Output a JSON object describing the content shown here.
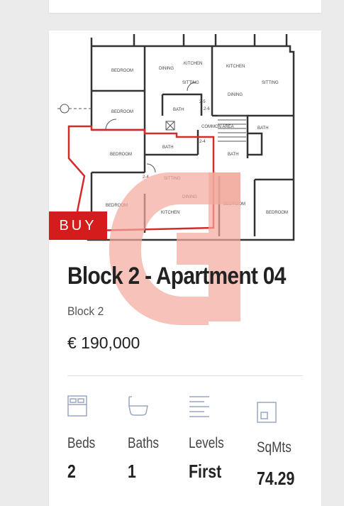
{
  "listing": {
    "badge": "BUY",
    "title": "Block 2 - Apartment 04",
    "block": "Block 2",
    "price": "€ 190,000",
    "watermark_color": "#f2a89c",
    "accent_color": "#d41c1c"
  },
  "floorplan": {
    "labels": [
      "BEDROOM",
      "DINING",
      "KITCHEN",
      "KITCHEN",
      "SITTING",
      "SITTING",
      "DINING",
      "BEDROOM",
      "BATH",
      "2-5",
      "2-6",
      "COMMON AREA",
      "BATH",
      "BEDROOM",
      "BATH",
      "2-4",
      "BATH",
      "2-4",
      "SITTING",
      "DINING",
      "BEDROOM",
      "KITCHEN",
      "BEDROOM",
      "BEDROOM"
    ]
  },
  "stats": [
    {
      "icon": "bed-icon",
      "label": "Beds",
      "value": "2"
    },
    {
      "icon": "bath-icon",
      "label": "Baths",
      "value": "1"
    },
    {
      "icon": "levels-icon",
      "label": "Levels",
      "value": "First"
    },
    {
      "icon": "area-icon",
      "label": "SqMts",
      "value": "74.29"
    }
  ]
}
